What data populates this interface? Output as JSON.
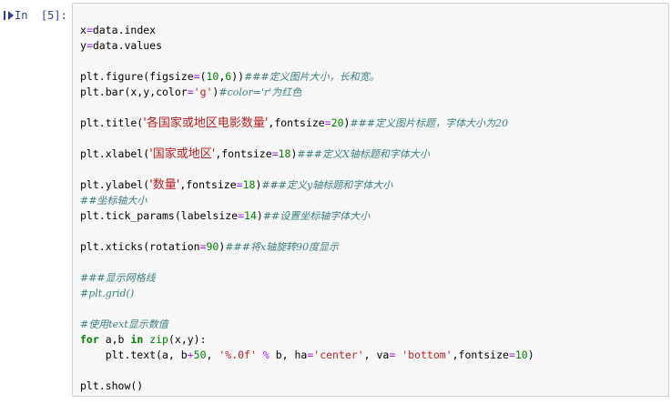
{
  "cell": {
    "prompt_label": "In  [5]:"
  },
  "code": {
    "l1": {
      "a": "x",
      "b": "=",
      "c": "data.index"
    },
    "l2": {
      "a": "y",
      "b": "=",
      "c": "data.values"
    },
    "l4": {
      "a": "plt.figure(figsize",
      "b": "=",
      "c": "(",
      "d": "10",
      "e": ",",
      "f": "6",
      "g": "))",
      "h": "###定义图片大小，长和宽。"
    },
    "l5": {
      "a": "plt.bar(x,y,color",
      "b": "=",
      "c": "'g'",
      "d": ")",
      "e": "#color='r'为红色"
    },
    "l7": {
      "a": "plt.title(",
      "b": "'各国家或地区电影数量'",
      "c": ",fontsize",
      "d": "=",
      "e": "20",
      "f": ")",
      "g": "###定义图片标题，字体大小为20"
    },
    "l9": {
      "a": "plt.xlabel(",
      "b": "'国家或地区'",
      "c": ",fontsize",
      "d": "=",
      "e": "18",
      "f": ")",
      "g": "###定义X轴标题和字体大小"
    },
    "l11": {
      "a": "plt.ylabel(",
      "b": "'数量'",
      "c": ",fontsize",
      "d": "=",
      "e": "18",
      "f": ")",
      "g": "###定义y轴标题和字体大小"
    },
    "l12": {
      "a": "##坐标轴大小"
    },
    "l13": {
      "a": "plt.tick_params(labelsize",
      "b": "=",
      "c": "14",
      "d": ")",
      "e": "##设置坐标轴字体大小"
    },
    "l15": {
      "a": "plt.xticks(rotation",
      "b": "=",
      "c": "90",
      "d": ")",
      "e": "###将x轴旋转90度显示"
    },
    "l17": {
      "a": "###显示网格线"
    },
    "l18": {
      "a": "#plt.grid()"
    },
    "l20": {
      "a": "#使用text显示数值"
    },
    "l21": {
      "a": "for",
      "b": " a,b ",
      "c": "in",
      "d": " ",
      "e": "zip",
      "f": "(x,y):"
    },
    "l22": {
      "a": "    plt.text(a, b",
      "b": "+",
      "c": "50",
      "d": ", ",
      "e": "'%.0f'",
      "f": " ",
      "g": "%",
      "h": " b, ha",
      "i": "=",
      "j": "'center'",
      "k": ", va",
      "l": "=",
      "m": " ",
      "n": "'bottom'",
      "o": ",fontsize",
      "p": "=",
      "q": "10",
      "r": ")"
    },
    "l24": {
      "a": "plt.show()"
    }
  }
}
